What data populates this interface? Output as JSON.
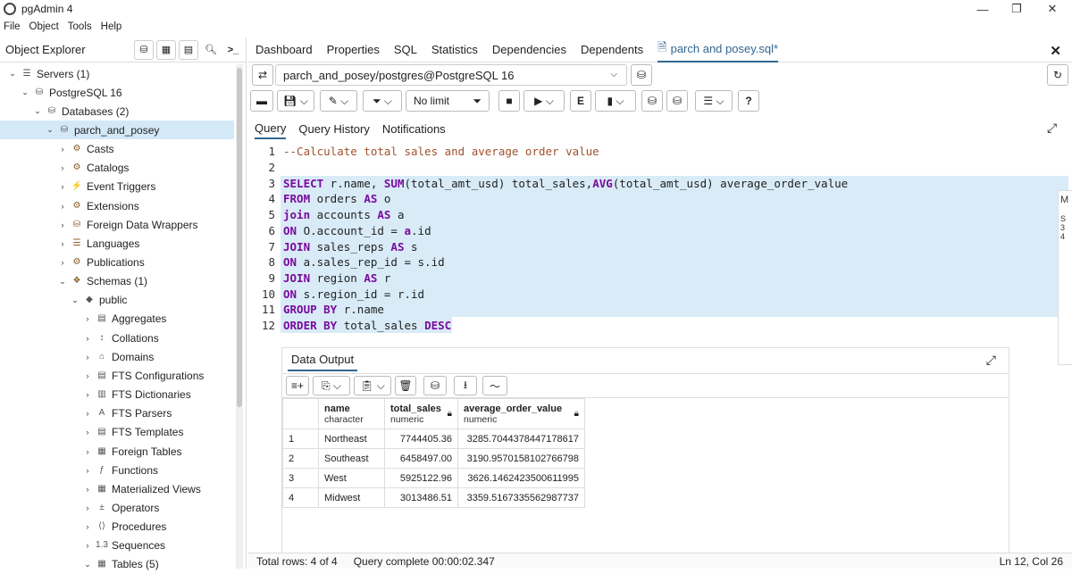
{
  "window": {
    "title": "pgAdmin 4"
  },
  "menu": [
    "File",
    "Object",
    "Tools",
    "Help"
  ],
  "object_explorer": {
    "title": "Object Explorer",
    "tree": [
      {
        "label": "Servers (1)",
        "depth": 0
      },
      {
        "label": "PostgreSQL 16",
        "depth": 1
      },
      {
        "label": "Databases (2)",
        "depth": 2
      },
      {
        "label": "parch_and_posey",
        "depth": 3
      },
      {
        "label": "Casts",
        "depth": 4
      },
      {
        "label": "Catalogs",
        "depth": 4
      },
      {
        "label": "Event Triggers",
        "depth": 4
      },
      {
        "label": "Extensions",
        "depth": 4
      },
      {
        "label": "Foreign Data Wrappers",
        "depth": 4
      },
      {
        "label": "Languages",
        "depth": 4
      },
      {
        "label": "Publications",
        "depth": 4
      },
      {
        "label": "Schemas (1)",
        "depth": 4
      },
      {
        "label": "public",
        "depth": 5
      },
      {
        "label": "Aggregates",
        "depth": 6
      },
      {
        "label": "Collations",
        "depth": 6
      },
      {
        "label": "Domains",
        "depth": 6
      },
      {
        "label": "FTS Configurations",
        "depth": 6
      },
      {
        "label": "FTS Dictionaries",
        "depth": 6
      },
      {
        "label": "FTS Parsers",
        "depth": 6
      },
      {
        "label": "FTS Templates",
        "depth": 6
      },
      {
        "label": "Foreign Tables",
        "depth": 6
      },
      {
        "label": "Functions",
        "depth": 6
      },
      {
        "label": "Materialized Views",
        "depth": 6
      },
      {
        "label": "Operators",
        "depth": 6
      },
      {
        "label": "Procedures",
        "depth": 6
      },
      {
        "label": "Sequences",
        "depth": 6
      },
      {
        "label": "Tables (5)",
        "depth": 6
      }
    ]
  },
  "tabs": [
    "Dashboard",
    "Properties",
    "SQL",
    "Statistics",
    "Dependencies",
    "Dependents",
    "parch and posey.sql*"
  ],
  "connection": "parch_and_posey/postgres@PostgreSQL 16",
  "toolbar": {
    "limit": "No limit"
  },
  "query_tabs": [
    "Query",
    "Query History",
    "Notifications"
  ],
  "editor": {
    "lines": [
      "--Calculate total sales and average order value",
      "",
      "SELECT r.name, SUM(total_amt_usd) total_sales,AVG(total_amt_usd) average_order_value",
      "FROM orders AS o",
      "join accounts AS a",
      "ON O.account_id = a.id",
      "JOIN sales_reps AS s",
      "ON a.sales_rep_id = s.id",
      "JOIN region AS r",
      "ON s.region_id = r.id",
      "GROUP BY r.name",
      "ORDER BY total_sales DESC"
    ]
  },
  "side_peek": [
    "M",
    "S",
    "3",
    "4"
  ],
  "data_output": {
    "tab": "Data Output",
    "columns": [
      {
        "name": "name",
        "type": "character"
      },
      {
        "name": "total_sales",
        "type": "numeric"
      },
      {
        "name": "average_order_value",
        "type": "numeric"
      }
    ],
    "rows": [
      [
        "1",
        "Northeast",
        "7744405.36",
        "3285.7044378447178617"
      ],
      [
        "2",
        "Southeast",
        "6458497.00",
        "3190.9570158102766798"
      ],
      [
        "3",
        "West",
        "5925122.96",
        "3626.1462423500611995"
      ],
      [
        "4",
        "Midwest",
        "3013486.51",
        "3359.5167335562987737"
      ]
    ]
  },
  "status": {
    "rows": "Total rows: 4 of 4",
    "query": "Query complete 00:00:02.347",
    "position": "Ln 12, Col 26"
  },
  "colors": {
    "accent": "#326690",
    "selection": "#d8ebf7",
    "keyword": "#7a0a9e",
    "comment": "#a0522d"
  }
}
